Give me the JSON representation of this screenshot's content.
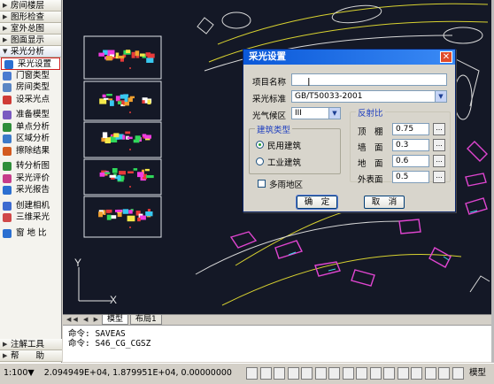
{
  "left_panel": {
    "sections_top": [
      {
        "label": "房间楼层"
      },
      {
        "label": "图形检查"
      },
      {
        "label": "室外总图"
      },
      {
        "label": "图面显示"
      }
    ],
    "open_section": {
      "label": "采光分析"
    },
    "items": [
      {
        "label": "采光设置",
        "icon": "window-icon",
        "color": "#2b6fd1"
      },
      {
        "label": "门窗类型",
        "icon": "door-icon",
        "color": "#4a7bd0"
      },
      {
        "label": "房间类型",
        "icon": "room-icon",
        "color": "#5a86c4"
      },
      {
        "label": "设采光点",
        "icon": "point-icon",
        "color": "#cf3b35"
      },
      {
        "label": "准备模型",
        "icon": "model-icon",
        "color": "#7a5ac0"
      },
      {
        "label": "单点分析",
        "icon": "single-point-icon",
        "color": "#2f8e3a"
      },
      {
        "label": "区域分析",
        "icon": "area-icon",
        "color": "#3b7ac9"
      },
      {
        "label": "擦除结果",
        "icon": "erase-icon",
        "color": "#d35a1f"
      },
      {
        "label": "转分析图",
        "icon": "convert-icon",
        "color": "#2f8e3a"
      },
      {
        "label": "采光评价",
        "icon": "evaluate-icon",
        "color": "#c63c8a"
      },
      {
        "label": "采光报告",
        "icon": "report-icon",
        "color": "#2b6fd1"
      },
      {
        "label": "创建相机",
        "icon": "camera-icon",
        "color": "#3d6bd0"
      },
      {
        "label": "三维采光",
        "icon": "3d-icon",
        "color": "#d04848"
      },
      {
        "label": "窗 地 比",
        "icon": "ratio-icon",
        "color": "#2b6fd1"
      }
    ],
    "sections_bottom": [
      {
        "label": "注解工具"
      },
      {
        "label": "帮　　助"
      }
    ]
  },
  "drawing_tabs": {
    "model": "模型",
    "layout": "布局1"
  },
  "command_lines": [
    "命令:  SAVEAS",
    "命令:  S46_CG_CGSZ"
  ],
  "status_bar": {
    "scale": "1:100▼",
    "coordinates": "2.094949E+04,  1.879951E+04,  0.00000000",
    "model_label": "模型"
  },
  "axis": {
    "y": "Y",
    "x": "X"
  },
  "dialog": {
    "title": "采光设置",
    "project_name_label": "项目名称",
    "project_name_value": "",
    "standard_label": "采光标准",
    "standard_value": "GB/T50033-2001",
    "climate_label": "光气候区",
    "climate_value": "III",
    "building_group": "建筑类型",
    "radio_civil": "民用建筑",
    "radio_industrial": "工业建筑",
    "radio_civil_selected": true,
    "reflect_group": "反射比",
    "ceiling_label": "顶　棚",
    "ceiling_value": "0.75",
    "wall_label": "墙　面",
    "wall_value": "0.3",
    "floor_label": "地　面",
    "floor_value": "0.6",
    "exterior_label": "外表面",
    "exterior_value": "0.5",
    "multi_rain_label": "多雨地区",
    "multi_rain_checked": false,
    "ok_label": "确　定",
    "cancel_label": "取　消",
    "more_label": "..."
  }
}
